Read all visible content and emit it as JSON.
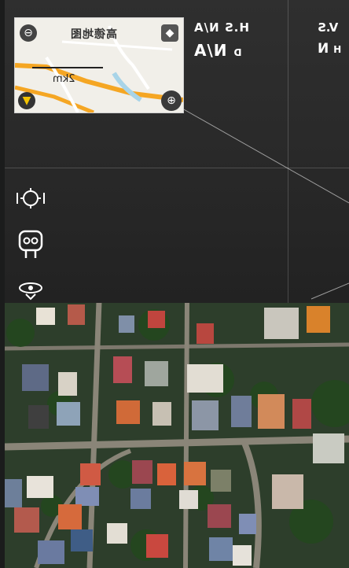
{
  "map": {
    "title": "高德地图",
    "scale": "2km"
  },
  "telemetry": {
    "hs_label": "H.S",
    "hs_value": "N/A",
    "d_label": "D",
    "d_value": "N/A",
    "vs_label": "V.S",
    "h_label": "H",
    "h_value": "N"
  },
  "controls": {
    "target_icon": "target-icon",
    "robot_icon": "robot-icon",
    "eye_icon": "eye-icon"
  },
  "colors": {
    "hud": "#2c2c2c",
    "map_bg": "#f1efe9",
    "road_major": "#f5a623",
    "road_minor": "#ffffff",
    "water": "#a8d4e8",
    "accent_yellow": "#f3c300"
  }
}
